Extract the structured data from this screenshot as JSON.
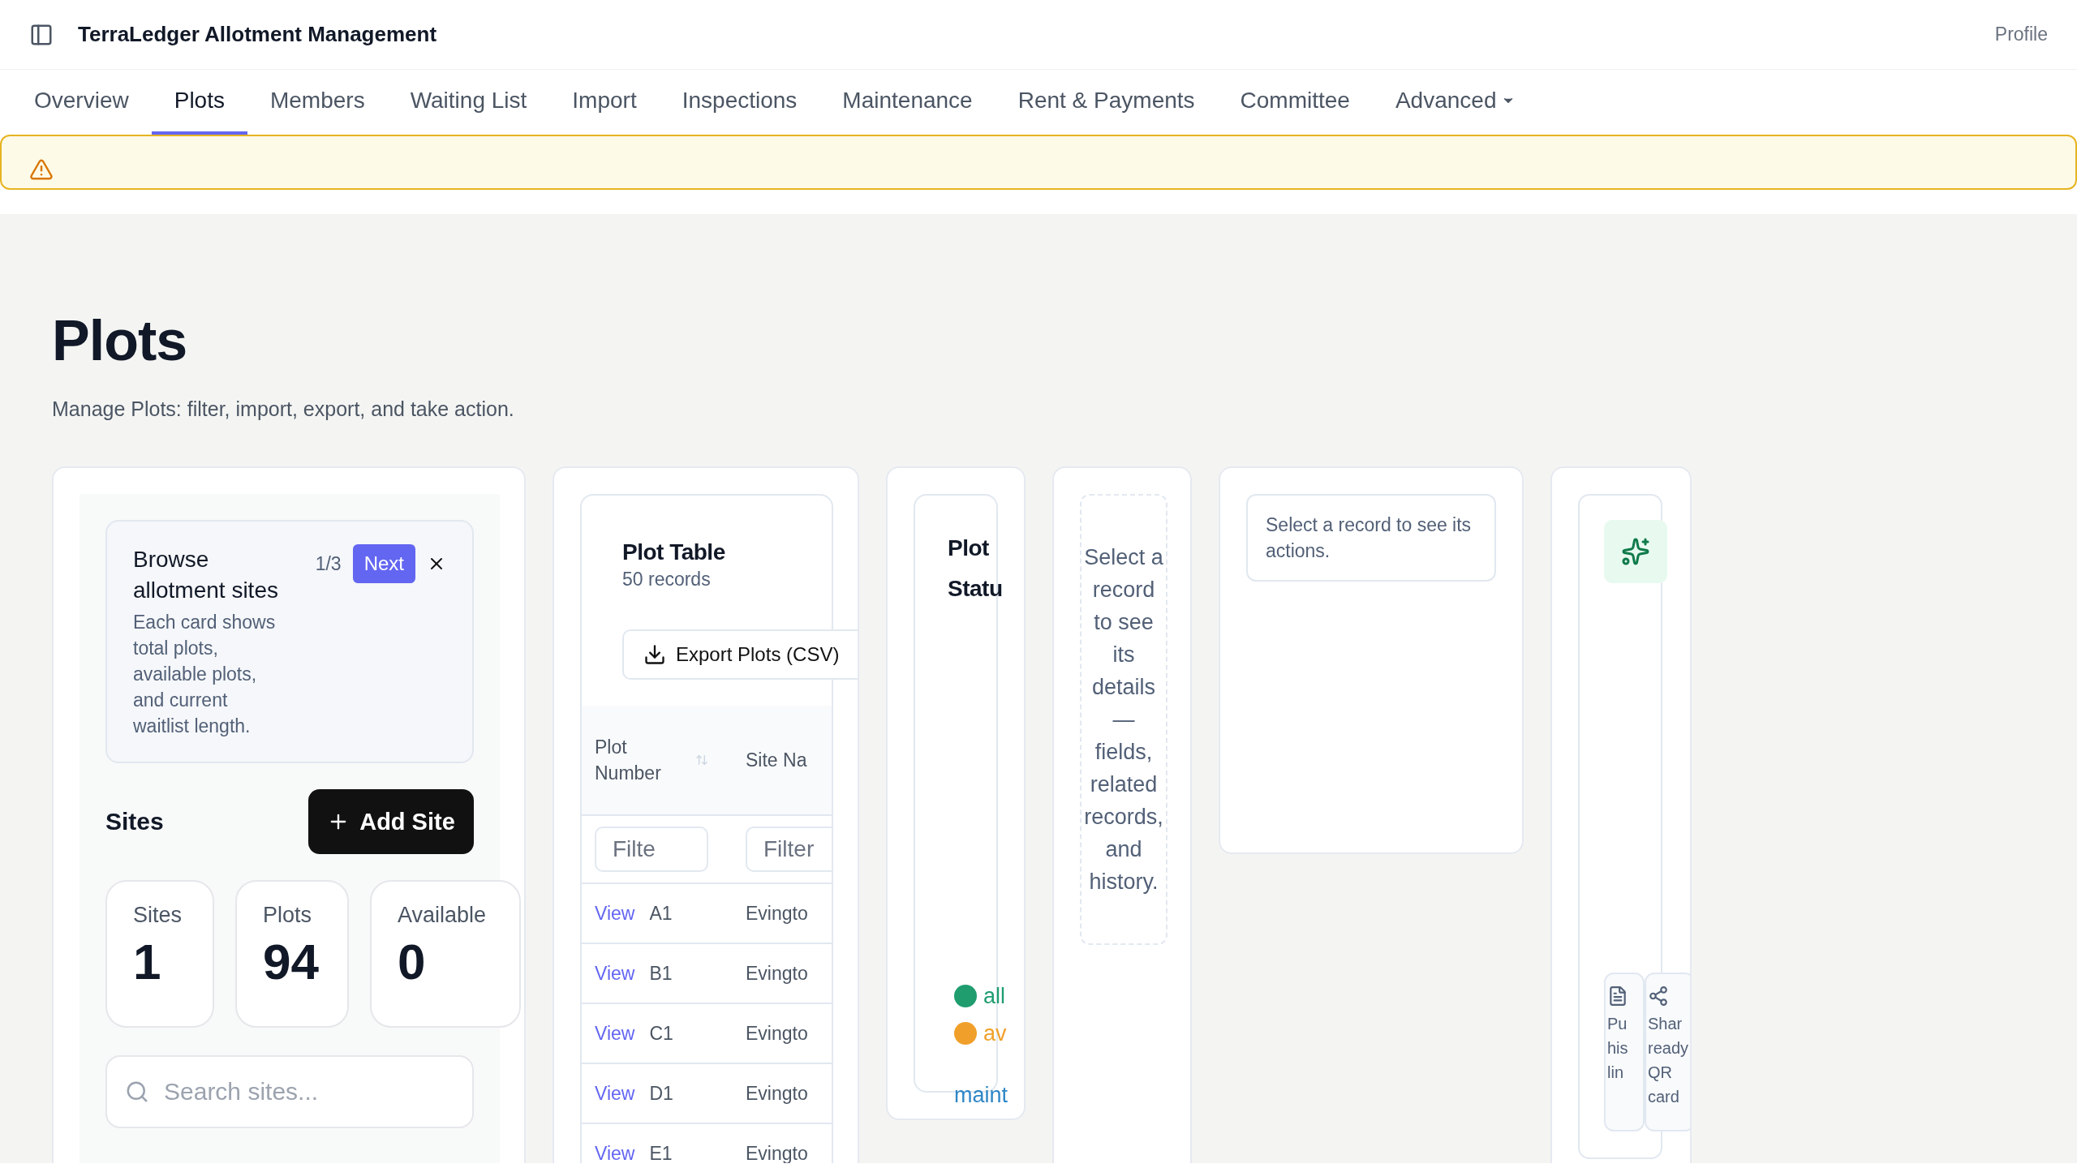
{
  "header": {
    "title": "TerraLedger Allotment Management",
    "profile": "Profile"
  },
  "tabs": [
    {
      "label": "Overview",
      "selected": false,
      "kind": "tab"
    },
    {
      "label": "Plots",
      "selected": true,
      "kind": "tab"
    },
    {
      "label": "Members",
      "selected": false,
      "kind": "tab"
    },
    {
      "label": "Waiting List",
      "selected": false,
      "kind": "tab"
    },
    {
      "label": "Import",
      "selected": false,
      "kind": "tab"
    },
    {
      "label": "Inspections",
      "selected": false,
      "kind": "tab"
    },
    {
      "label": "Maintenance",
      "selected": false,
      "kind": "tab"
    },
    {
      "label": "Rent & Payments",
      "selected": false,
      "kind": "tab"
    },
    {
      "label": "Committee",
      "selected": false,
      "kind": "tab"
    },
    {
      "label": "Advanced",
      "selected": false,
      "kind": "dropdown"
    }
  ],
  "alert": {
    "kind": "warning"
  },
  "page": {
    "title": "Plots",
    "subtitle": "Manage Plots: filter, import, export, and take action."
  },
  "sites_panel": {
    "tour": {
      "title": "Browse allotment sites",
      "body": "Each card shows total plots, available plots, and current waitlist length.",
      "step": "1/3",
      "next": "Next"
    },
    "heading": "Sites",
    "add_button": "Add Site",
    "stats": [
      {
        "label": "Sites",
        "value": "1"
      },
      {
        "label": "Plots",
        "value": "94"
      },
      {
        "label": "Available",
        "value": "0"
      }
    ],
    "search": {
      "placeholder": "Search sites..."
    }
  },
  "plot_table": {
    "title": "Plot Table",
    "count": "50 records",
    "export_button": "Export Plots (CSV)",
    "columns": [
      {
        "label": "Plot Number",
        "sortable": true
      },
      {
        "label": "Site Na",
        "sortable": false
      }
    ],
    "filters": [
      {
        "placeholder": "Filte"
      },
      {
        "placeholder": "Filter"
      }
    ],
    "rows": [
      {
        "action": "View",
        "plot": "A1",
        "site": "Evingto"
      },
      {
        "action": "View",
        "plot": "B1",
        "site": "Evingto"
      },
      {
        "action": "View",
        "plot": "C1",
        "site": "Evingto"
      },
      {
        "action": "View",
        "plot": "D1",
        "site": "Evingto"
      },
      {
        "action": "View",
        "plot": "E1",
        "site": "Evingto"
      }
    ]
  },
  "plot_status": {
    "title": "Plot Statu",
    "legend": [
      {
        "label": "all",
        "color": "#1f9d6f",
        "dot": true
      },
      {
        "label": "av",
        "color": "#f0a02a",
        "dot": true
      },
      {
        "label": "maint",
        "color": "#2f86c6",
        "dot": false
      }
    ]
  },
  "details": {
    "empty_text": "Select a record to see its details — fields, related records, and history."
  },
  "actions": {
    "empty_text": "Select a record to see its actions."
  },
  "tools": {
    "tiles": [
      {
        "kind": "document",
        "label": "Pu his lin"
      },
      {
        "kind": "share",
        "label": "Shar ready QR card"
      }
    ]
  }
}
